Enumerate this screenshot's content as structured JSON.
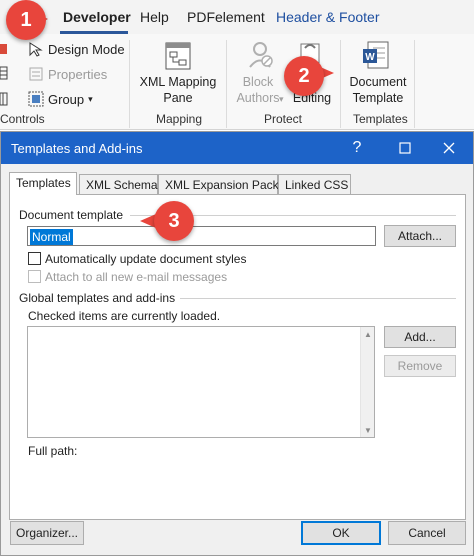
{
  "ribbon": {
    "tabs": [
      {
        "label": "Developer",
        "active": true
      },
      {
        "label": "Help"
      },
      {
        "label": "PDFelement"
      },
      {
        "label": "Header & Footer"
      }
    ],
    "controls_group": {
      "items": [
        "Design Mode",
        "Properties",
        "Group"
      ],
      "label": "Controls"
    },
    "mapping_group": {
      "button_line1": "XML Mapping",
      "button_line2": "Pane",
      "label": "Mapping"
    },
    "protect_group": {
      "block_line1": "Block",
      "block_line2": "Authors",
      "editing": "Editing",
      "label": "Protect"
    },
    "templates_group": {
      "button_line1": "Document",
      "button_line2": "Template",
      "label": "Templates"
    }
  },
  "callouts": [
    "1",
    "2",
    "3"
  ],
  "dialog": {
    "title": "Templates and Add-ins",
    "help_glyph": "?",
    "tabs": [
      "Templates",
      "XML Schema",
      "XML Expansion Packs",
      "Linked CSS"
    ],
    "document_template_label": "Document template",
    "template_value": "Normal",
    "attach_button": "Attach...",
    "auto_update_label": "Automatically update document styles",
    "attach_email_label": "Attach to all new e-mail messages",
    "global_templates_label": "Global templates and add-ins",
    "checked_loaded_text": "Checked items are currently loaded.",
    "add_button": "Add...",
    "remove_button": "Remove",
    "full_path_label": "Full path:",
    "organizer_button": "Organizer...",
    "ok_button": "OK",
    "cancel_button": "Cancel"
  },
  "colors": {
    "titlebar": "#1d63c8",
    "callout": "#e8453c",
    "selection": "#0078d7",
    "header_footer_tab": "#1e4fa0"
  }
}
